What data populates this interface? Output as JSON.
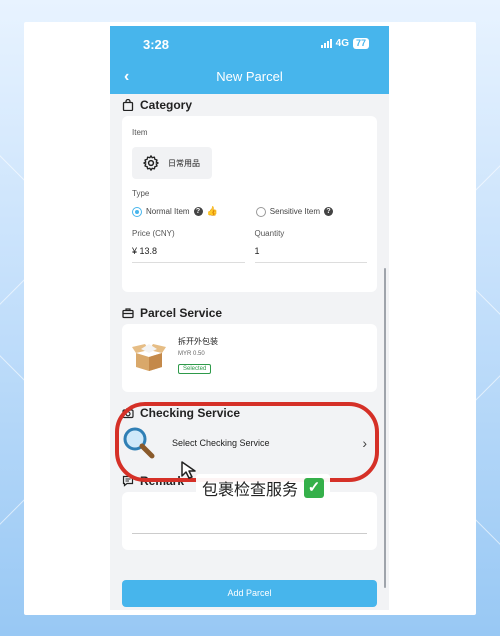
{
  "status": {
    "time": "3:28",
    "network": "4G",
    "battery": "77"
  },
  "nav": {
    "back": "‹",
    "title": "New Parcel"
  },
  "category": {
    "title": "Category",
    "item_label": "Item",
    "item_value": "日常用品",
    "type_label": "Type",
    "normal_item": "Normal Item",
    "sensitive_item": "Sensitive Item",
    "price_label": "Price (CNY)",
    "price_value": "¥ 13.8",
    "quantity_label": "Quantity",
    "quantity_value": "1"
  },
  "parcel_service": {
    "title": "Parcel Service",
    "name": "拆开外包装",
    "price": "MYR 0.50",
    "badge": "Selected"
  },
  "checking_service": {
    "title": "Checking Service",
    "select_label": "Select Checking Service",
    "chevron": "›"
  },
  "remark": {
    "title": "Remark"
  },
  "add_button": "Add Parcel",
  "annotation": {
    "text": "包裹检查服务",
    "tick": "✓"
  },
  "colors": {
    "accent": "#47b5ec",
    "highlight": "#d53027",
    "selected_green": "#2e9a4a"
  }
}
